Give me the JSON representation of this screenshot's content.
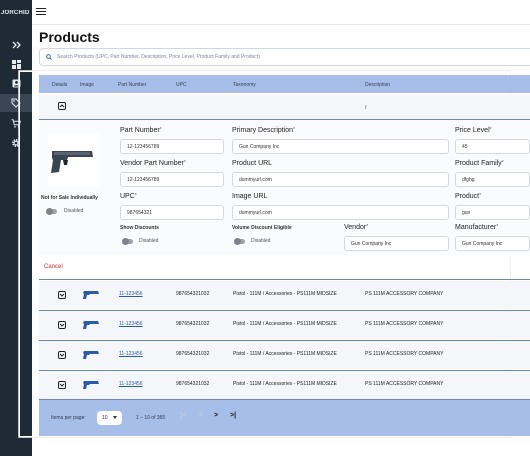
{
  "app": {
    "brand": "JORCHID",
    "title": "Products"
  },
  "sidebar": {
    "items": [
      {
        "icon": "double-chevron-right-icon"
      },
      {
        "icon": "dashboard-icon"
      },
      {
        "icon": "contact-card-icon"
      },
      {
        "icon": "tag-icon"
      },
      {
        "icon": "cart-icon"
      },
      {
        "icon": "gear-icon"
      }
    ]
  },
  "search": {
    "placeholder": "Search Products (UPC, Part Number, Description, Price Level, Product Family and Product)"
  },
  "table": {
    "headers": {
      "details": "Details",
      "image": "Image",
      "part_number": "Part Number",
      "upc": "UPC",
      "taxonomy": "Taxonomy",
      "description": "Description"
    },
    "expanded_row": {
      "description": "/"
    }
  },
  "form": {
    "part_number": {
      "label": "Part Number",
      "value": "12-123456789"
    },
    "primary_description": {
      "label": "Primary Description",
      "value": "Gun Company Inc"
    },
    "price_level": {
      "label": "Price Level",
      "value": "45"
    },
    "vendor_part_number": {
      "label": "Vendor Part Number",
      "value": "12-123456789"
    },
    "product_url": {
      "label": "Product URL",
      "value": "dummyurl.com"
    },
    "product_family": {
      "label": "Product Family",
      "value": "dfghg"
    },
    "upc": {
      "label": "UPC",
      "value": "987654321"
    },
    "image_url": {
      "label": "Image URL",
      "value": "dummyurl.com"
    },
    "product": {
      "label": "Product",
      "value": "gun"
    },
    "show_discounts": {
      "label": "Show Discounts",
      "state": "Disabled"
    },
    "volume_discount": {
      "label": "Volume Discount Eligible",
      "state": "Disabled"
    },
    "vendor": {
      "label": "Vendor",
      "value": "Gun Company Inc"
    },
    "manufacturer": {
      "label": "Manufacturer",
      "value": "Gun Company Inc"
    },
    "not_for_sale": {
      "label": "Not for Sale Individually",
      "state": "Disabled"
    },
    "required_mark": "*",
    "cancel": "Cancel"
  },
  "rows": [
    {
      "part_number": "11-123456",
      "upc": "987654321032",
      "taxonomy": "Pistol - 111M / Accessories - PS111M MIDSIZE",
      "description": "PS 111M ACCESSORY COMPANY"
    },
    {
      "part_number": "11-123456",
      "upc": "987654321032",
      "taxonomy": "Pistol - 111M / Accessories - PS111M MIDSIZE",
      "description": "PS 111M ACCESSORY COMPANY"
    },
    {
      "part_number": "11-123456",
      "upc": "987654321032",
      "taxonomy": "Pistol - 111M / Accessories - PS111M MIDSIZE",
      "description": "PS 111M ACCESSORY COMPANY"
    },
    {
      "part_number": "11-123456",
      "upc": "987654321032",
      "taxonomy": "Pistol - 111M / Accessories - PS111M MIDSIZE",
      "description": "PS 111M ACCESSORY COMPANY"
    }
  ],
  "pagination": {
    "items_per_page_label": "Items per page:",
    "page_size": "10",
    "range": "1 – 10 of 365",
    "first": "|<",
    "prev": "<",
    "next": ">",
    "last": ">|"
  },
  "colors": {
    "sidebar": "#1e2a36",
    "header": "#a7bfe8",
    "accent": "#2b5aa9",
    "cancel": "#e0282e"
  }
}
